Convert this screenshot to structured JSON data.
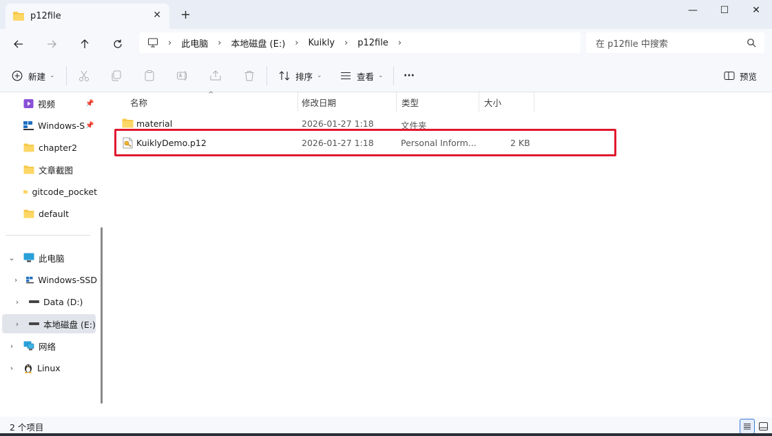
{
  "window": {
    "tab_title": "p12file",
    "tab_close": "✕",
    "new_tab": "+",
    "minimize": "—",
    "maximize": "☐",
    "close": "✕"
  },
  "nav": {
    "breadcrumbs": [
      "此电脑",
      "本地磁盘 (E:)",
      "Kuikly",
      "p12file"
    ],
    "search_placeholder": "在 p12file 中搜索"
  },
  "toolbar": {
    "new_label": "新建",
    "sort_label": "排序",
    "view_label": "查看",
    "more_label": "···",
    "preview_label": "预览"
  },
  "sidebar": {
    "quick_access": [
      {
        "label": "视频",
        "icon": "video-icon",
        "pinned": true
      },
      {
        "label": "Windows-SSD",
        "icon": "windows-drive-icon",
        "pinned": true
      },
      {
        "label": "chapter2",
        "icon": "folder-icon"
      },
      {
        "label": "文章截图",
        "icon": "folder-icon"
      },
      {
        "label": "gitcode_pocket",
        "icon": "folder-icon"
      },
      {
        "label": "default",
        "icon": "folder-icon"
      }
    ],
    "this_pc": "此电脑",
    "drives": [
      {
        "label": "Windows-SSD",
        "icon": "windows-drive-icon"
      },
      {
        "label": "Data (D:)",
        "icon": "drive-icon"
      },
      {
        "label": "本地磁盘 (E:)",
        "icon": "drive-icon",
        "selected": true
      }
    ],
    "network": "网络",
    "linux": "Linux"
  },
  "columns": {
    "name": "名称",
    "modified": "修改日期",
    "type": "类型",
    "size": "大小"
  },
  "files": [
    {
      "name": "material",
      "modified": "2026-01-27 1:18",
      "type": "文件夹",
      "size": "",
      "icon": "folder-icon"
    },
    {
      "name": "KuiklyDemo.p12",
      "modified": "2026-01-27 1:18",
      "type": "Personal Inform...",
      "size": "2 KB",
      "icon": "certificate-file-icon"
    }
  ],
  "status": {
    "item_count": "2 个项目"
  },
  "colors": {
    "accent": "#0067c0",
    "highlight_box": "#e0182d",
    "folder": "#f8c94a"
  }
}
